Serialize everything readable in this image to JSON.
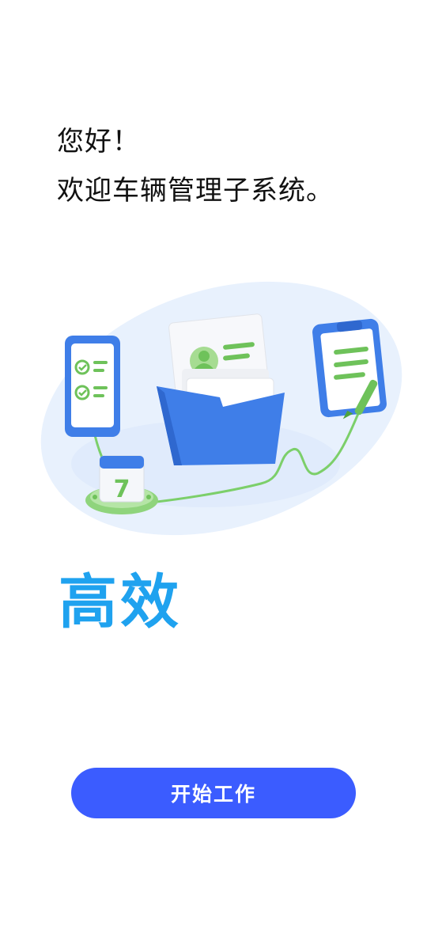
{
  "welcome": {
    "line1": "您好！",
    "line2": "欢迎车辆管理子系统。"
  },
  "illustration": {
    "calendar_day": "7",
    "colors": {
      "blob": "#e8f1fd",
      "blue": "#3f7ee8",
      "green": "#6ec25a"
    }
  },
  "slogan": {
    "text": "高效",
    "color": "#1fa2ef"
  },
  "start_button": {
    "label": "开始工作",
    "color": "#3b5cff"
  }
}
